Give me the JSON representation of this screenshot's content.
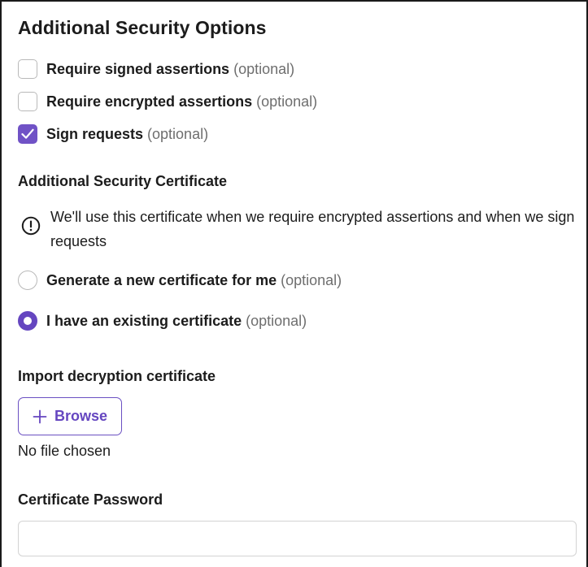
{
  "title": "Additional Security Options",
  "optional_suffix": "(optional)",
  "checkboxes": [
    {
      "label": "Require signed assertions",
      "checked": false
    },
    {
      "label": "Require encrypted assertions",
      "checked": false
    },
    {
      "label": "Sign requests",
      "checked": true
    }
  ],
  "certificate_section": {
    "heading": "Additional Security Certificate",
    "info_icon": "info-circle-icon",
    "info_text": "We'll use this certificate when we require encrypted assertions and when we sign requests"
  },
  "radios": [
    {
      "label": "Generate a new certificate for me",
      "checked": false
    },
    {
      "label": "I have an existing certificate",
      "checked": true
    }
  ],
  "import": {
    "heading": "Import decryption certificate",
    "browse_label": "Browse",
    "browse_icon": "plus-icon",
    "file_status": "No file chosen"
  },
  "password": {
    "heading": "Certificate Password",
    "value": "",
    "placeholder": ""
  },
  "colors": {
    "accent": "#6546c0",
    "checkbox_checked": "#7052c6",
    "border": "#b9b9b9",
    "muted_text": "#6e6e6e"
  }
}
